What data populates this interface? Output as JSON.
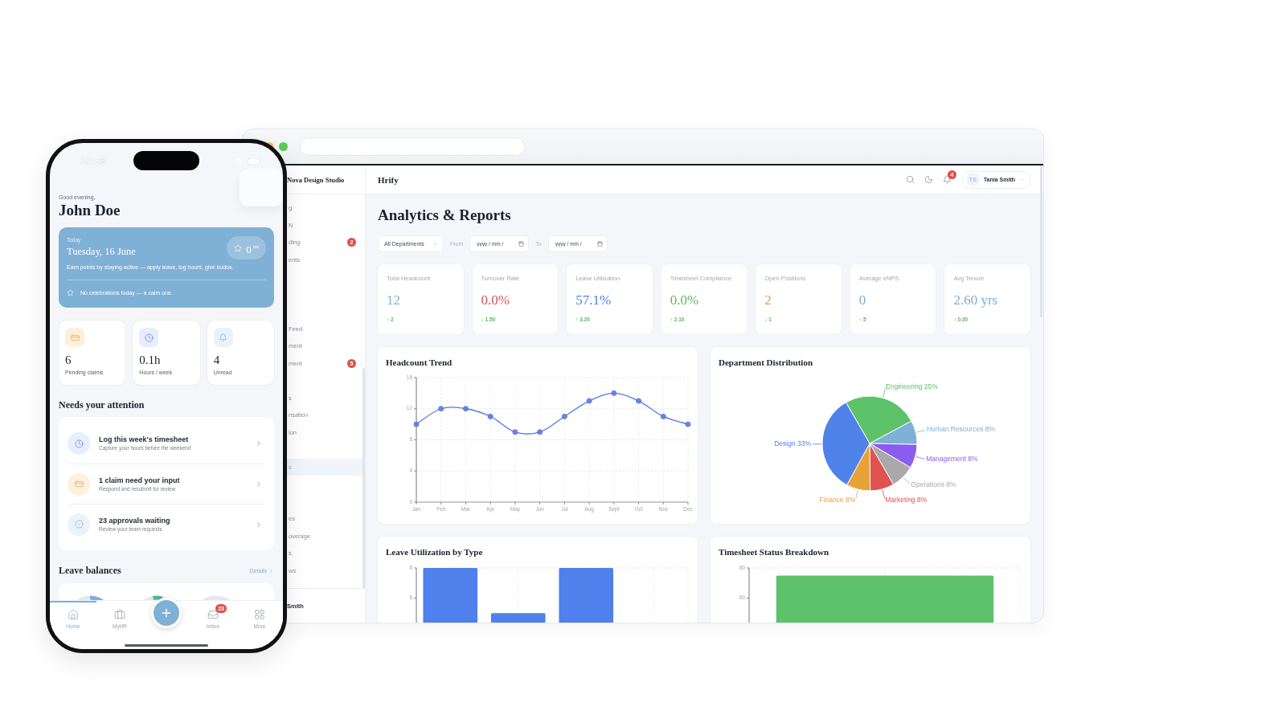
{
  "browser": {
    "sidebar": {
      "company": "Nova Design Studio",
      "sections": [
        [
          {
            "label": "g",
            "selected": false
          },
          {
            "label": "N",
            "selected": false
          },
          {
            "label": "ding",
            "badge": "2",
            "selected": false
          },
          {
            "label": "ents",
            "selected": false
          }
        ],
        [
          {
            "label": "Feed",
            "selected": false
          },
          {
            "label": "ment",
            "selected": false
          },
          {
            "label": "ment",
            "badge": "5",
            "selected": false
          }
        ],
        [
          {
            "label": "s",
            "selected": false
          },
          {
            "label": "nsation",
            "selected": false
          },
          {
            "label": "ion",
            "selected": false
          }
        ],
        [
          {
            "label": "s",
            "selected": true
          }
        ],
        [
          {
            "label": "es",
            "selected": false
          },
          {
            "label": "overage",
            "selected": false
          },
          {
            "label": "s",
            "selected": false
          },
          {
            "label": "ws",
            "selected": false
          }
        ]
      ],
      "user": "Smith"
    },
    "header": {
      "title": "Hrify",
      "notification_count": "4",
      "user": {
        "initials": "TS",
        "name": "Tania Smith"
      }
    },
    "page": {
      "title": "Analytics & Reports",
      "filters": {
        "department": "All Departments",
        "from_label": "From",
        "from": {
          "placeholder": "yyyy / mm /"
        },
        "to_label": "To",
        "to": {
          "placeholder": "yyyy / mm /"
        }
      },
      "kpis": [
        {
          "label": "Total Headcount",
          "value": "12",
          "delta": "↑ 2",
          "color": "#7fb0d6"
        },
        {
          "label": "Turnover Rate",
          "value": "0.0%",
          "delta": "↓ 1.50",
          "color": "#d9534f"
        },
        {
          "label": "Leave Utilization",
          "value": "57.1%",
          "delta": "↑ 3.20",
          "color": "#4f7fe8"
        },
        {
          "label": "Timesheet Compliance",
          "value": "0.0%",
          "delta": "↑ 2.10",
          "color": "#5cb85c"
        },
        {
          "label": "Open Positions",
          "value": "2",
          "delta": "↓ 1",
          "color": "#e8a23a"
        },
        {
          "label": "Average eNPS",
          "value": "0",
          "delta": "↑ 5",
          "color": "#7fb0d6"
        },
        {
          "label": "Avg Tenure",
          "value": "2.60 yrs",
          "delta": "↑ 0.30",
          "color": "#7fb0d6"
        }
      ],
      "charts": [
        {
          "title": "Headcount Trend",
          "chart_data": {
            "type": "line",
            "categories": [
              "Jan",
              "Feb",
              "Mar",
              "Apr",
              "May",
              "Jun",
              "Jul",
              "Aug",
              "Sept",
              "Oct",
              "Nov",
              "Dec"
            ],
            "series": [
              {
                "color": "#5b78e0",
                "marker": "circle",
                "values": [
                  10,
                  12,
                  12,
                  11,
                  9,
                  9,
                  11,
                  13,
                  14,
                  13,
                  11,
                  10
                ]
              }
            ],
            "ylim": [
              0,
              16
            ],
            "yticks": [
              0,
              4,
              8,
              12,
              16
            ],
            "grid": true
          }
        },
        {
          "title": "Department Distribution",
          "chart_data": {
            "type": "pie",
            "categories": [
              "Engineering",
              "Human Resources",
              "Management",
              "Operations",
              "Marketing",
              "Finance",
              "Design"
            ],
            "values": [
              25,
              8,
              8,
              8,
              8,
              8,
              33
            ],
            "colors": [
              "#5dc26a",
              "#7fb0d6",
              "#8a5cf0",
              "#a9a9a9",
              "#e05252",
              "#e8a23a",
              "#4f83ea"
            ],
            "value_labels": [
              "25%",
              "8%",
              "8%",
              "8%",
              "8%",
              "8%",
              "33%"
            ]
          }
        },
        {
          "title": "Leave Utilization by Type",
          "chart_data": {
            "type": "bar",
            "series": [
              {
                "color": "#4f80ec",
                "values": [
                  8,
                  5,
                  8,
                  null
                ]
              }
            ],
            "ylim": [
              4.16,
              8
            ],
            "yticks": [
              6,
              8
            ],
            "grid": true
          }
        },
        {
          "title": "Timesheet Status Breakdown",
          "chart_data": {
            "type": "bar",
            "series": [
              {
                "color": "#5dc26a",
                "values": [
                  75
                ]
              }
            ],
            "ylim": [
              41.6,
              80
            ],
            "yticks": [
              60,
              80
            ],
            "grid": true
          }
        }
      ]
    }
  },
  "phone": {
    "status_time": "20:53",
    "greeting": "Good evening,",
    "name": "John Doe",
    "today_card": {
      "label": "Today",
      "date": "Tuesday, 16 June",
      "points": "0$^{pts}$",
      "hint": "Earn points by staying active — apply leave, log hours, give kudos.",
      "celebration": "No celebrations today — a calm one."
    },
    "stats": [
      {
        "kind": "claims",
        "value": "6",
        "label": "Pending claims"
      },
      {
        "kind": "hours",
        "value": "0.1h",
        "label": "Hours / week"
      },
      {
        "kind": "unread",
        "value": "4",
        "label": "Unread"
      }
    ],
    "attention": {
      "title": "Needs your attention",
      "items": [
        {
          "kind": "timesheet",
          "title": "Log this week's timesheet",
          "subtitle": "Capture your hours before the weekend"
        },
        {
          "kind": "claim",
          "title": "1 claim need your input",
          "subtitle": "Respond and resubmit for review"
        },
        {
          "kind": "approval",
          "title": "23 approvals waiting",
          "subtitle": "Review your team requests"
        }
      ]
    },
    "leave": {
      "title": "Leave balances",
      "link": "Details"
    },
    "nav": [
      {
        "kind": "home",
        "label": "Home",
        "selected": true
      },
      {
        "kind": "myhr",
        "label": "MyHR",
        "selected": false
      },
      {
        "kind": "inbox",
        "label": "Inbox",
        "badge": "23",
        "selected": false
      },
      {
        "kind": "more",
        "label": "More",
        "selected": false
      }
    ]
  }
}
